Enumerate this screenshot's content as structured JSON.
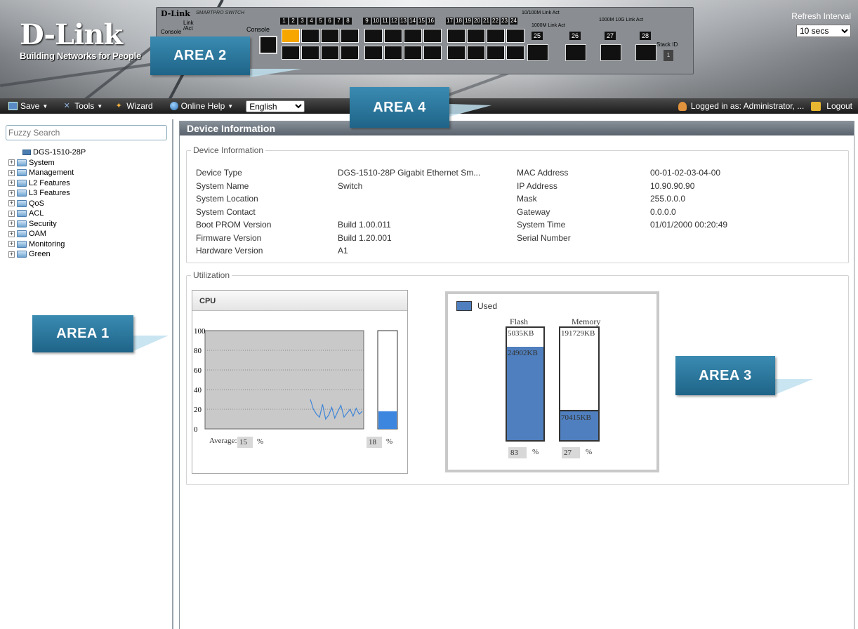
{
  "header": {
    "logo_brand": "D-Link",
    "logo_tagline": "Building Networks for People",
    "device_brand": "D-Link",
    "device_series": "SMARTPRO SWITCH",
    "console_label": "Console",
    "link_label": "Link",
    "act_label": "/Act",
    "console_port_label": "Console",
    "stack_id_label": "Stack ID",
    "stack_id_value": "1",
    "port_numbers_a": [
      "1",
      "2",
      "3",
      "4",
      "5",
      "6",
      "7",
      "8"
    ],
    "port_numbers_b": [
      "9",
      "10",
      "11",
      "12",
      "13",
      "14",
      "15",
      "16"
    ],
    "port_numbers_c": [
      "17",
      "18",
      "19",
      "20",
      "21",
      "22",
      "23",
      "24"
    ],
    "sfp_numbers": [
      "25",
      "26",
      "27",
      "28"
    ],
    "speed_legend_1": "10/100M Link Act",
    "speed_legend_2": "1000M Link Act",
    "speed_legend_3": "1000M 10G Link Act",
    "refresh_label": "Refresh Interval",
    "refresh_value": "10 secs"
  },
  "toolbar": {
    "save": "Save",
    "tools": "Tools",
    "wizard": "Wizard",
    "online_help": "Online Help",
    "language": "English",
    "logged_in": "Logged in as: Administrator, ...",
    "logout": "Logout"
  },
  "areas": {
    "area1": "AREA 1",
    "area2": "AREA 2",
    "area3": "AREA 3",
    "area4": "AREA 4",
    "color": "#2a79a2"
  },
  "sidebar": {
    "search_placeholder": "Fuzzy Search",
    "root": "DGS-1510-28P",
    "items": [
      "System",
      "Management",
      "L2 Features",
      "L3 Features",
      "QoS",
      "ACL",
      "Security",
      "OAM",
      "Monitoring",
      "Green"
    ]
  },
  "main": {
    "title": "Device Information",
    "info_legend": "Device Information",
    "left_fields": [
      {
        "label": "Device Type",
        "value": "DGS-1510-28P Gigabit Ethernet Sm..."
      },
      {
        "label": "System Name",
        "value": "Switch"
      },
      {
        "label": "System Location",
        "value": ""
      },
      {
        "label": "System Contact",
        "value": ""
      },
      {
        "label": "Boot PROM Version",
        "value": "Build 1.00.011"
      },
      {
        "label": "Firmware Version",
        "value": "Build 1.20.001"
      },
      {
        "label": "Hardware Version",
        "value": "A1"
      }
    ],
    "right_fields": [
      {
        "label": "MAC Address",
        "value": "00-01-02-03-04-00"
      },
      {
        "label": "IP Address",
        "value": "10.90.90.90"
      },
      {
        "label": "Mask",
        "value": "255.0.0.0"
      },
      {
        "label": "Gateway",
        "value": "0.0.0.0"
      },
      {
        "label": "System Time",
        "value": "01/01/2000 00:20:49"
      },
      {
        "label": "Serial Number",
        "value": ""
      }
    ],
    "util_legend": "Utilization",
    "cpu_title": "CPU",
    "average_label": "Average:",
    "average_value": "15",
    "current_value": "18",
    "percent_sign": "%",
    "used_label": "Used",
    "flash_label": "Flash",
    "memory_label": "Memory",
    "flash_free": "5035KB",
    "flash_used": "24902KB",
    "flash_pct": "83",
    "memory_free": "191729KB",
    "memory_used": "70415KB",
    "memory_pct": "27",
    "used_color": "#4f7fbe"
  },
  "chart_data": {
    "type": "line",
    "title": "CPU",
    "yticks": [
      "0",
      "20",
      "40",
      "60",
      "80",
      "100"
    ],
    "ylim": [
      0,
      100
    ],
    "grid": true,
    "series": [
      {
        "values": [
          30,
          20,
          15,
          12,
          25,
          10,
          14,
          22,
          11,
          18,
          24,
          12,
          16,
          20,
          13,
          21,
          15,
          18
        ]
      }
    ],
    "current": 18
  }
}
